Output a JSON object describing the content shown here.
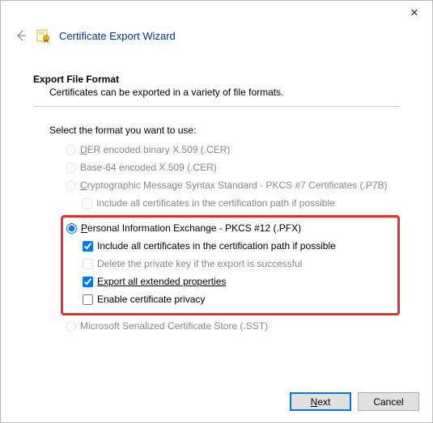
{
  "wizard_title": "Certificate Export Wizard",
  "section": {
    "title": "Export File Format",
    "description": "Certificates can be exported in a variety of file formats."
  },
  "select_label": "Select the format you want to use:",
  "options": {
    "der": {
      "prefix": "D",
      "rest": "ER encoded binary X.509 (.CER)"
    },
    "base64": {
      "label": "Base-64 encoded X.509 (.CER)"
    },
    "pkcs7": {
      "prefix": "C",
      "rest": "ryptographic Message Syntax Standard - PKCS #7 Certificates (.P7B)"
    },
    "pkcs7_include": {
      "label": "Include all certificates in the certification path if possible"
    },
    "pfx": {
      "prefix": "P",
      "rest": "ersonal Information Exchange - PKCS #12 (.PFX)"
    },
    "pfx_include": {
      "label": "Include all certificates in the certification path if possible"
    },
    "pfx_delete": {
      "label": "Delete the private key if the export is successful"
    },
    "pfx_extended": {
      "prefix": "Export all extended properties"
    },
    "pfx_privacy": {
      "label": "Enable certificate privacy"
    },
    "sst": {
      "label": "Microsoft Serialized Certificate Store (.SST)"
    }
  },
  "buttons": {
    "next_prefix": "N",
    "next_rest": "ext",
    "cancel": "Cancel"
  }
}
